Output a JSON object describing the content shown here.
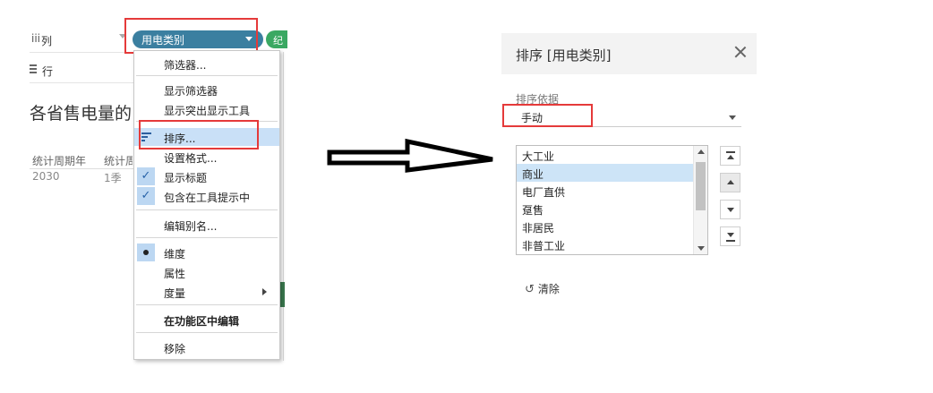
{
  "shelves": {
    "columns_icon": "iii",
    "columns_label": "列",
    "rows_label": "行",
    "pill_label": "用电类别",
    "pill_green_label": "纪"
  },
  "worksheet": {
    "title": "各省售电量的",
    "headers": [
      "统计周期年",
      "统计周"
    ],
    "values": [
      "2030",
      "1季"
    ]
  },
  "context_menu": {
    "items": [
      {
        "label": "筛选器..."
      },
      {
        "label": "显示筛选器"
      },
      {
        "label": "显示突出显示工具"
      },
      {
        "label": "排序..."
      },
      {
        "label": "设置格式..."
      },
      {
        "label": "显示标题"
      },
      {
        "label": "包含在工具提示中"
      },
      {
        "label": "编辑别名..."
      },
      {
        "label": "维度"
      },
      {
        "label": "属性"
      },
      {
        "label": "度量"
      },
      {
        "label": "在功能区中编辑"
      },
      {
        "label": "移除"
      }
    ]
  },
  "sort_dialog": {
    "title": "排序 [用电类别]",
    "sort_by_label": "排序依据",
    "sort_by_value": "手动",
    "list_items": [
      "大工业",
      "商业",
      "电厂直供",
      "趸售",
      "非居民",
      "非普工业"
    ],
    "selected_item": "商业",
    "clear_label": "清除"
  },
  "colors": {
    "pill": "#3b7fa0",
    "highlight_box": "#e53a3a",
    "menu_highlight": "#c9e0f7",
    "list_selection": "#cde4f7"
  },
  "icons": {
    "close": "close-icon",
    "sort": "sort-icon",
    "check": "checkmark-icon",
    "radio": "radio-dot-icon",
    "submenu": "chevron-right-icon",
    "clear": "undo-icon"
  }
}
